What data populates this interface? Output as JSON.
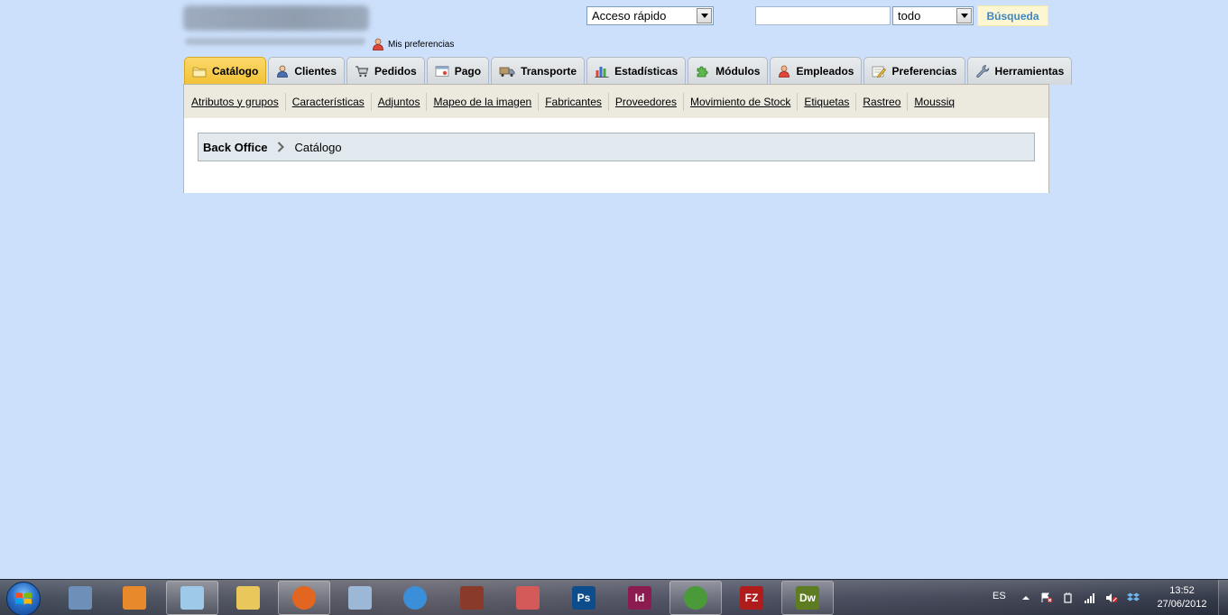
{
  "header": {
    "my_preferences_label": "Mis preferencias",
    "quick_access_value": "Acceso rápido",
    "search_input_value": "",
    "search_scope_value": "todo",
    "search_button_label": "Búsqueda"
  },
  "tabs": [
    {
      "label": "Catálogo",
      "icon": "folder-icon",
      "active": true
    },
    {
      "label": "Clientes",
      "icon": "user-icon",
      "active": false
    },
    {
      "label": "Pedidos",
      "icon": "cart-icon",
      "active": false
    },
    {
      "label": "Pago",
      "icon": "payment-icon",
      "active": false
    },
    {
      "label": "Transporte",
      "icon": "truck-icon",
      "active": false
    },
    {
      "label": "Estadísticas",
      "icon": "bar-chart-icon",
      "active": false
    },
    {
      "label": "Módulos",
      "icon": "puzzle-icon",
      "active": false
    },
    {
      "label": "Empleados",
      "icon": "employee-icon",
      "active": false
    },
    {
      "label": "Preferencias",
      "icon": "preferences-icon",
      "active": false
    },
    {
      "label": "Herramientas",
      "icon": "wrench-icon",
      "active": false
    }
  ],
  "submenu": [
    "Atributos y grupos",
    "Características",
    "Adjuntos",
    "Mapeo de la imagen",
    "Fabricantes",
    "Proveedores",
    "Movimiento de Stock",
    "Etiquetas",
    "Rastreo",
    "Moussiq"
  ],
  "breadcrumb": {
    "home": "Back Office",
    "current": "Catálogo"
  },
  "taskbar": {
    "apps": [
      {
        "name": "image-viewer-icon",
        "color": "#6d8fb8",
        "open": false
      },
      {
        "name": "media-player-icon",
        "color": "#e8892b",
        "open": false
      },
      {
        "name": "notes-app-icon",
        "color": "#9fc9e8",
        "open": true
      },
      {
        "name": "file-explorer-icon",
        "color": "#e9c75a",
        "open": false
      },
      {
        "name": "firefox-icon",
        "color": "#e2661f",
        "open": true
      },
      {
        "name": "calculator-icon",
        "color": "#9db7d6",
        "open": false
      },
      {
        "name": "sync-app-icon",
        "color": "#3b8fd8",
        "open": false
      },
      {
        "name": "fireworks-app-icon",
        "color": "#8a3a2a",
        "open": false
      },
      {
        "name": "snipping-tool-icon",
        "color": "#d45a5a",
        "open": false
      },
      {
        "name": "photoshop-icon",
        "color": "#0e4d8c",
        "label": "Ps",
        "open": false
      },
      {
        "name": "indesign-icon",
        "color": "#8c1c4f",
        "label": "Id",
        "open": false
      },
      {
        "name": "chrome-icon",
        "color": "#4a9a3a",
        "open": true
      },
      {
        "name": "filezilla-icon",
        "color": "#b01b1b",
        "label": "FZ",
        "open": false
      },
      {
        "name": "dreamweaver-icon",
        "color": "#5e7d22",
        "label": "Dw",
        "open": true
      }
    ],
    "language": "ES",
    "time": "13:52",
    "date": "27/06/2012"
  }
}
